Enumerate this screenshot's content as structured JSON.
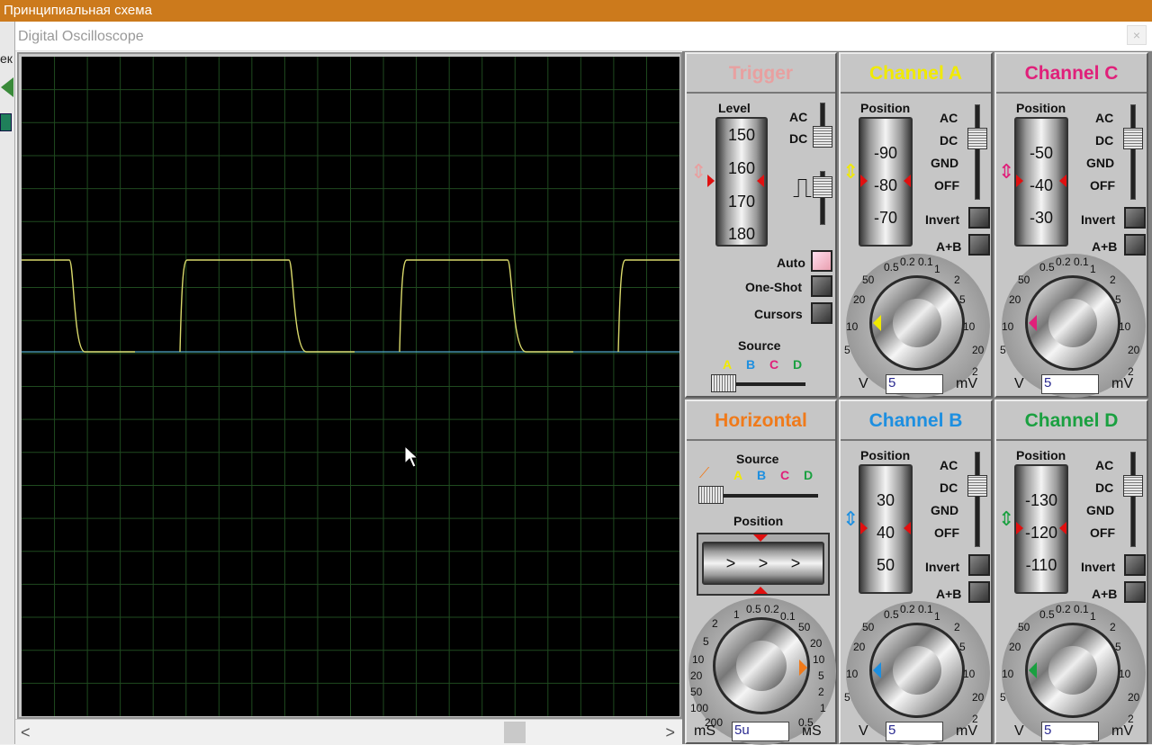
{
  "window": {
    "parent_title": "Принципиальная схема",
    "title": "Digital Oscilloscope",
    "close": "×",
    "left_strip_text": "ек"
  },
  "scrollbar": {
    "left_arrow": "<",
    "right_arrow": ">"
  },
  "screen": {
    "trace_color": "#d8d86a",
    "baseline_color": "#4fa7c8",
    "grid_color": "#1f4a1f"
  },
  "trigger": {
    "title": "Trigger",
    "level_label": "Level",
    "level_values": [
      "150",
      "160",
      "170",
      "180"
    ],
    "coupling": [
      "AC",
      "DC"
    ],
    "auto": "Auto",
    "one_shot": "One-Shot",
    "cursors": "Cursors",
    "source_label": "Source",
    "source_options": [
      "A",
      "B",
      "C",
      "D"
    ]
  },
  "channel_a": {
    "title": "Channel A",
    "position_label": "Position",
    "position_values": [
      "-90",
      "-80",
      "-70"
    ],
    "coupling": [
      "AC",
      "DC",
      "GND",
      "OFF"
    ],
    "invert": "Invert",
    "a_plus_b": "A+B",
    "scale": [
      "0.5",
      "0.2",
      "0.1",
      "1",
      "50",
      "2",
      "20",
      "5",
      "10",
      "10",
      "5",
      "20",
      "2"
    ],
    "value": "5",
    "unit_left": "V",
    "unit_right": "mV"
  },
  "channel_c": {
    "title": "Channel C",
    "position_label": "Position",
    "position_values": [
      "-50",
      "-40",
      "-30"
    ],
    "coupling": [
      "AC",
      "DC",
      "GND",
      "OFF"
    ],
    "invert": "Invert",
    "a_plus_b": "A+B",
    "scale": [
      "0.5",
      "0.2",
      "0.1",
      "1",
      "50",
      "2",
      "20",
      "5",
      "10",
      "10",
      "5",
      "20",
      "2"
    ],
    "value": "5",
    "unit_left": "V",
    "unit_right": "mV"
  },
  "horizontal": {
    "title": "Horizontal",
    "source_label": "Source",
    "source_options": [
      "A",
      "B",
      "C",
      "D"
    ],
    "position_label": "Position",
    "position_marks": [
      ">",
      ">",
      ">"
    ],
    "scale": [
      "1",
      "0.5",
      "0.2",
      "0.1",
      "2",
      "50",
      "5",
      "20",
      "10",
      "10",
      "20",
      "5",
      "50",
      "2",
      "100",
      "1",
      "200",
      "0.5"
    ],
    "value": "5u",
    "unit_left": "mS",
    "unit_right": "мS"
  },
  "channel_b": {
    "title": "Channel B",
    "position_label": "Position",
    "position_values": [
      "30",
      "40",
      "50"
    ],
    "coupling": [
      "AC",
      "DC",
      "GND",
      "OFF"
    ],
    "invert": "Invert",
    "a_plus_b": "A+B",
    "scale": [
      "0.5",
      "0.2",
      "0.1",
      "1",
      "50",
      "2",
      "20",
      "5",
      "10",
      "10",
      "5",
      "20",
      "2"
    ],
    "value": "5",
    "unit_left": "V",
    "unit_right": "mV"
  },
  "channel_d": {
    "title": "Channel D",
    "position_label": "Position",
    "position_values": [
      "-130",
      "-120",
      "-110"
    ],
    "coupling": [
      "AC",
      "DC",
      "GND",
      "OFF"
    ],
    "invert": "Invert",
    "a_plus_b": "A+B",
    "scale": [
      "0.5",
      "0.2",
      "0.1",
      "1",
      "50",
      "2",
      "20",
      "5",
      "10",
      "10",
      "5",
      "20",
      "2"
    ],
    "value": "5",
    "unit_left": "V",
    "unit_right": "mV"
  },
  "colors": {
    "trigger": "#e8a0a0",
    "channel_a": "#f0ea00",
    "channel_b": "#1d8fe0",
    "channel_c": "#e0207a",
    "channel_d": "#1aa040",
    "horizontal": "#f07a1a",
    "pointer": "#e01010"
  },
  "icons": {
    "cursor": "mouse-pointer-icon"
  }
}
